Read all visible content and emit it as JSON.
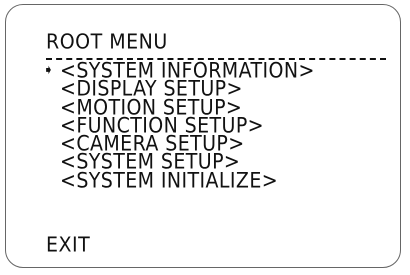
{
  "menu": {
    "title": "ROOT MENU",
    "cursor_icon": "arrow-right-icon",
    "items": [
      {
        "label": "<SYSTEM INFORMATION>",
        "selected": true
      },
      {
        "label": "<DISPLAY SETUP>",
        "selected": false
      },
      {
        "label": "<MOTION SETUP>",
        "selected": false
      },
      {
        "label": "<FUNCTION SETUP>",
        "selected": false
      },
      {
        "label": "<CAMERA SETUP>",
        "selected": false
      },
      {
        "label": "<SYSTEM SETUP>",
        "selected": false
      },
      {
        "label": "<SYSTEM INITIALIZE>",
        "selected": false
      }
    ],
    "exit_label": "EXIT"
  },
  "colors": {
    "text": "#111111",
    "frame_border": "#666666",
    "background": "#ffffff"
  }
}
